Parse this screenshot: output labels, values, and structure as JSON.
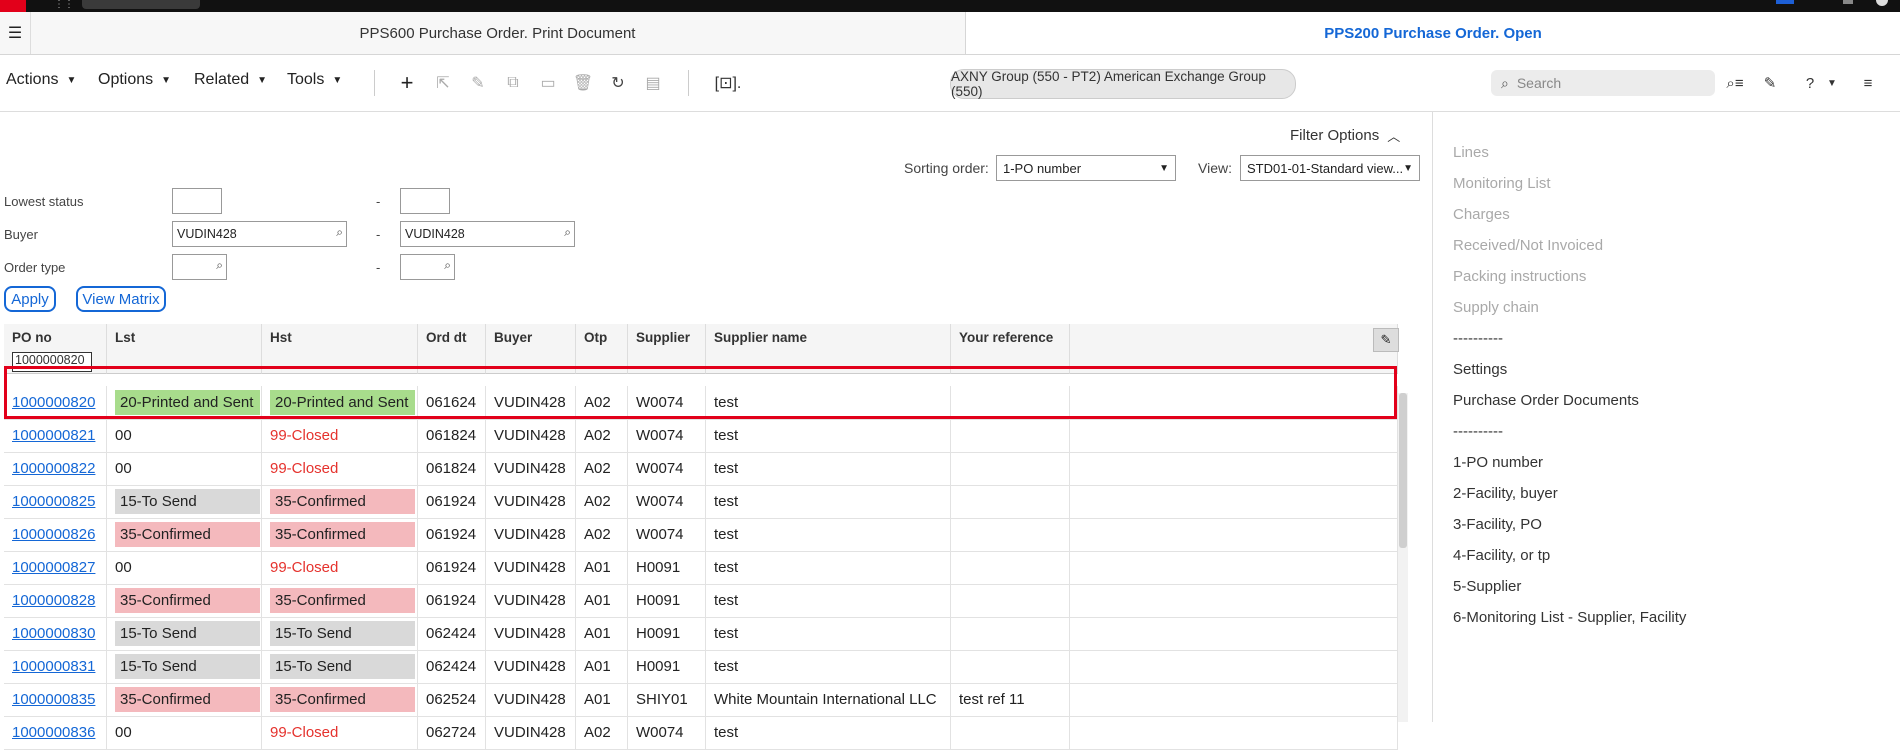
{
  "tabs": {
    "tab1": "PPS600 Purchase Order. Print Document",
    "tab2": "PPS200 Purchase Order. Open"
  },
  "toolbar": {
    "actions": "Actions",
    "options": "Options",
    "related": "Related",
    "tools": "Tools",
    "context": "AXNY Group (550 - PT2) American Exchange Group (550)",
    "search_placeholder": "Search"
  },
  "filter": {
    "filter_options": "Filter Options",
    "sorting_label": "Sorting order:",
    "sorting_value": "1-PO number",
    "view_label": "View:",
    "view_value": "STD01-01-Standard view...",
    "lowest_status_label": "Lowest status",
    "buyer_label": "Buyer",
    "order_type_label": "Order type",
    "buyer_from": "VUDIN428",
    "buyer_to": "VUDIN428",
    "dash": "-",
    "apply": "Apply",
    "view_matrix": "View Matrix"
  },
  "grid": {
    "headers": {
      "po": "PO no",
      "lst": "Lst",
      "hst": "Hst",
      "orddt": "Ord dt",
      "buyer": "Buyer",
      "otp": "Otp",
      "supplier": "Supplier",
      "suppname": "Supplier name",
      "yourref": "Your reference"
    },
    "po_filter": "1000000820",
    "rows": [
      {
        "po": "1000000820",
        "lst": "20-Printed and Sent",
        "hst": "20-Printed and Sent",
        "orddt": "061624",
        "buyer": "VUDIN428",
        "otp": "A02",
        "supplier": "W0074",
        "suppname": "test",
        "yourref": ""
      },
      {
        "po": "1000000821",
        "lst": "00",
        "hst": "99-Closed",
        "orddt": "061824",
        "buyer": "VUDIN428",
        "otp": "A02",
        "supplier": "W0074",
        "suppname": "test",
        "yourref": ""
      },
      {
        "po": "1000000822",
        "lst": "00",
        "hst": "99-Closed",
        "orddt": "061824",
        "buyer": "VUDIN428",
        "otp": "A02",
        "supplier": "W0074",
        "suppname": "test",
        "yourref": ""
      },
      {
        "po": "1000000825",
        "lst": "15-To Send",
        "hst": "35-Confirmed",
        "orddt": "061924",
        "buyer": "VUDIN428",
        "otp": "A02",
        "supplier": "W0074",
        "suppname": "test",
        "yourref": ""
      },
      {
        "po": "1000000826",
        "lst": "35-Confirmed",
        "hst": "35-Confirmed",
        "orddt": "061924",
        "buyer": "VUDIN428",
        "otp": "A02",
        "supplier": "W0074",
        "suppname": "test",
        "yourref": ""
      },
      {
        "po": "1000000827",
        "lst": "00",
        "hst": "99-Closed",
        "orddt": "061924",
        "buyer": "VUDIN428",
        "otp": "A01",
        "supplier": "H0091",
        "suppname": "test",
        "yourref": ""
      },
      {
        "po": "1000000828",
        "lst": "35-Confirmed",
        "hst": "35-Confirmed",
        "orddt": "061924",
        "buyer": "VUDIN428",
        "otp": "A01",
        "supplier": "H0091",
        "suppname": "test",
        "yourref": ""
      },
      {
        "po": "1000000830",
        "lst": "15-To Send",
        "hst": "15-To Send",
        "orddt": "062424",
        "buyer": "VUDIN428",
        "otp": "A01",
        "supplier": "H0091",
        "suppname": "test",
        "yourref": ""
      },
      {
        "po": "1000000831",
        "lst": "15-To Send",
        "hst": "15-To Send",
        "orddt": "062424",
        "buyer": "VUDIN428",
        "otp": "A01",
        "supplier": "H0091",
        "suppname": "test",
        "yourref": ""
      },
      {
        "po": "1000000835",
        "lst": "35-Confirmed",
        "hst": "35-Confirmed",
        "orddt": "062524",
        "buyer": "VUDIN428",
        "otp": "A01",
        "supplier": "SHIY01",
        "suppname": "White Mountain International LLC",
        "yourref": "test ref 11"
      },
      {
        "po": "1000000836",
        "lst": "00",
        "hst": "99-Closed",
        "orddt": "062724",
        "buyer": "VUDIN428",
        "otp": "A02",
        "supplier": "W0074",
        "suppname": "test",
        "yourref": ""
      }
    ]
  },
  "sidebar": {
    "items": [
      {
        "label": "Lines",
        "enabled": false
      },
      {
        "label": "Monitoring List",
        "enabled": false
      },
      {
        "label": "Charges",
        "enabled": false
      },
      {
        "label": "Received/Not Invoiced",
        "enabled": false
      },
      {
        "label": "Packing instructions",
        "enabled": false
      },
      {
        "label": "Supply chain",
        "enabled": false
      },
      {
        "label": "----------",
        "enabled": true
      },
      {
        "label": "Settings",
        "enabled": true
      },
      {
        "label": "Purchase Order Documents",
        "enabled": true
      },
      {
        "label": "----------",
        "enabled": true
      },
      {
        "label": "1-PO number",
        "enabled": true
      },
      {
        "label": "2-Facility, buyer",
        "enabled": true
      },
      {
        "label": "3-Facility, PO",
        "enabled": true
      },
      {
        "label": "4-Facility, or tp",
        "enabled": true
      },
      {
        "label": "5-Supplier",
        "enabled": true
      },
      {
        "label": "6-Monitoring List - Supplier, Facility",
        "enabled": true
      }
    ]
  },
  "colors": {
    "accent": "#1467d6",
    "status_green": "#a8dc8c",
    "status_gray": "#d9d9d9",
    "status_pink": "#f4b9bd",
    "closed_text": "#e5322d",
    "highlight": "#e2001a"
  }
}
